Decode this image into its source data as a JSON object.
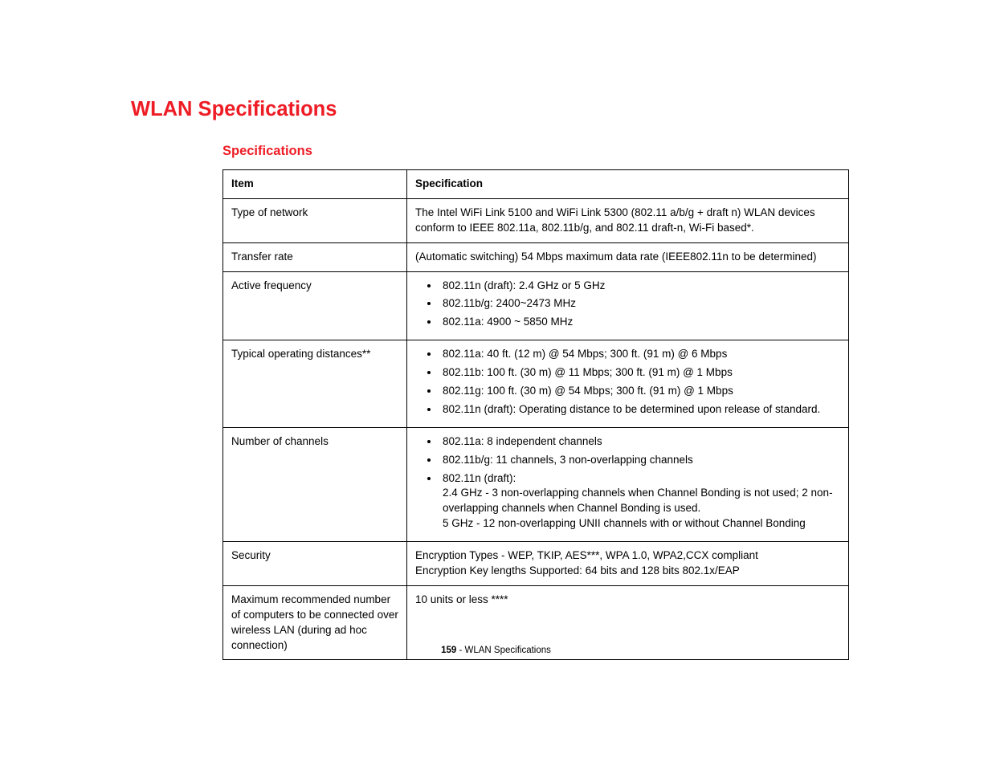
{
  "headings": {
    "main": "WLAN Specifications",
    "sub": "Specifications"
  },
  "table": {
    "headers": {
      "item": "Item",
      "spec": "Specification"
    },
    "rows": [
      {
        "item": "Type of network",
        "type": "text",
        "text": "The Intel WiFi Link 5100 and WiFi Link 5300 (802.11 a/b/g + draft n) WLAN devices conform to IEEE 802.11a, 802.11b/g, and 802.11 draft-n, Wi-Fi based*."
      },
      {
        "item": "Transfer rate",
        "type": "text",
        "text": "(Automatic switching) 54 Mbps maximum data rate (IEEE802.11n to be determined)"
      },
      {
        "item": "Active frequency",
        "type": "list",
        "items": [
          {
            "text": "802.11n (draft): 2.4 GHz or 5 GHz"
          },
          {
            "text": "802.11b/g: 2400~2473 MHz"
          },
          {
            "text": "802.11a: 4900 ~ 5850 MHz"
          }
        ]
      },
      {
        "item": "Typical operating distances**",
        "type": "list",
        "items": [
          {
            "text": "802.11a: 40 ft. (12 m) @ 54 Mbps; 300 ft. (91 m) @ 6 Mbps"
          },
          {
            "text": "802.11b: 100 ft. (30 m) @ 11 Mbps; 300 ft. (91 m) @ 1 Mbps"
          },
          {
            "text": "802.11g: 100 ft. (30 m) @ 54 Mbps; 300 ft. (91 m) @ 1 Mbps"
          },
          {
            "text": "802.11n (draft): Operating distance to be determined upon release of standard."
          }
        ]
      },
      {
        "item": "Number of channels",
        "type": "list",
        "items": [
          {
            "text": "802.11a: 8 independent channels"
          },
          {
            "text": "802.11b/g: 11 channels, 3 non-overlapping channels"
          },
          {
            "text": "802.11n (draft):",
            "sub": "2.4 GHz - 3 non-overlapping channels when Channel Bonding is not used; 2 non-overlapping channels when Channel Bonding is used.\n5 GHz - 12 non-overlapping UNII channels with or without Channel Bonding"
          }
        ]
      },
      {
        "item": "Security",
        "type": "text",
        "text": "Encryption Types - WEP, TKIP, AES***, WPA 1.0, WPA2,CCX compliant\nEncryption Key lengths Supported: 64 bits and 128 bits 802.1x/EAP"
      },
      {
        "item": "Maximum recommended number of computers to be connected over wireless LAN (during ad hoc connection)",
        "type": "text",
        "text": "10 units or less ****"
      }
    ]
  },
  "footer": {
    "page_number": "159",
    "sep": " - ",
    "title": "WLAN Specifications"
  }
}
